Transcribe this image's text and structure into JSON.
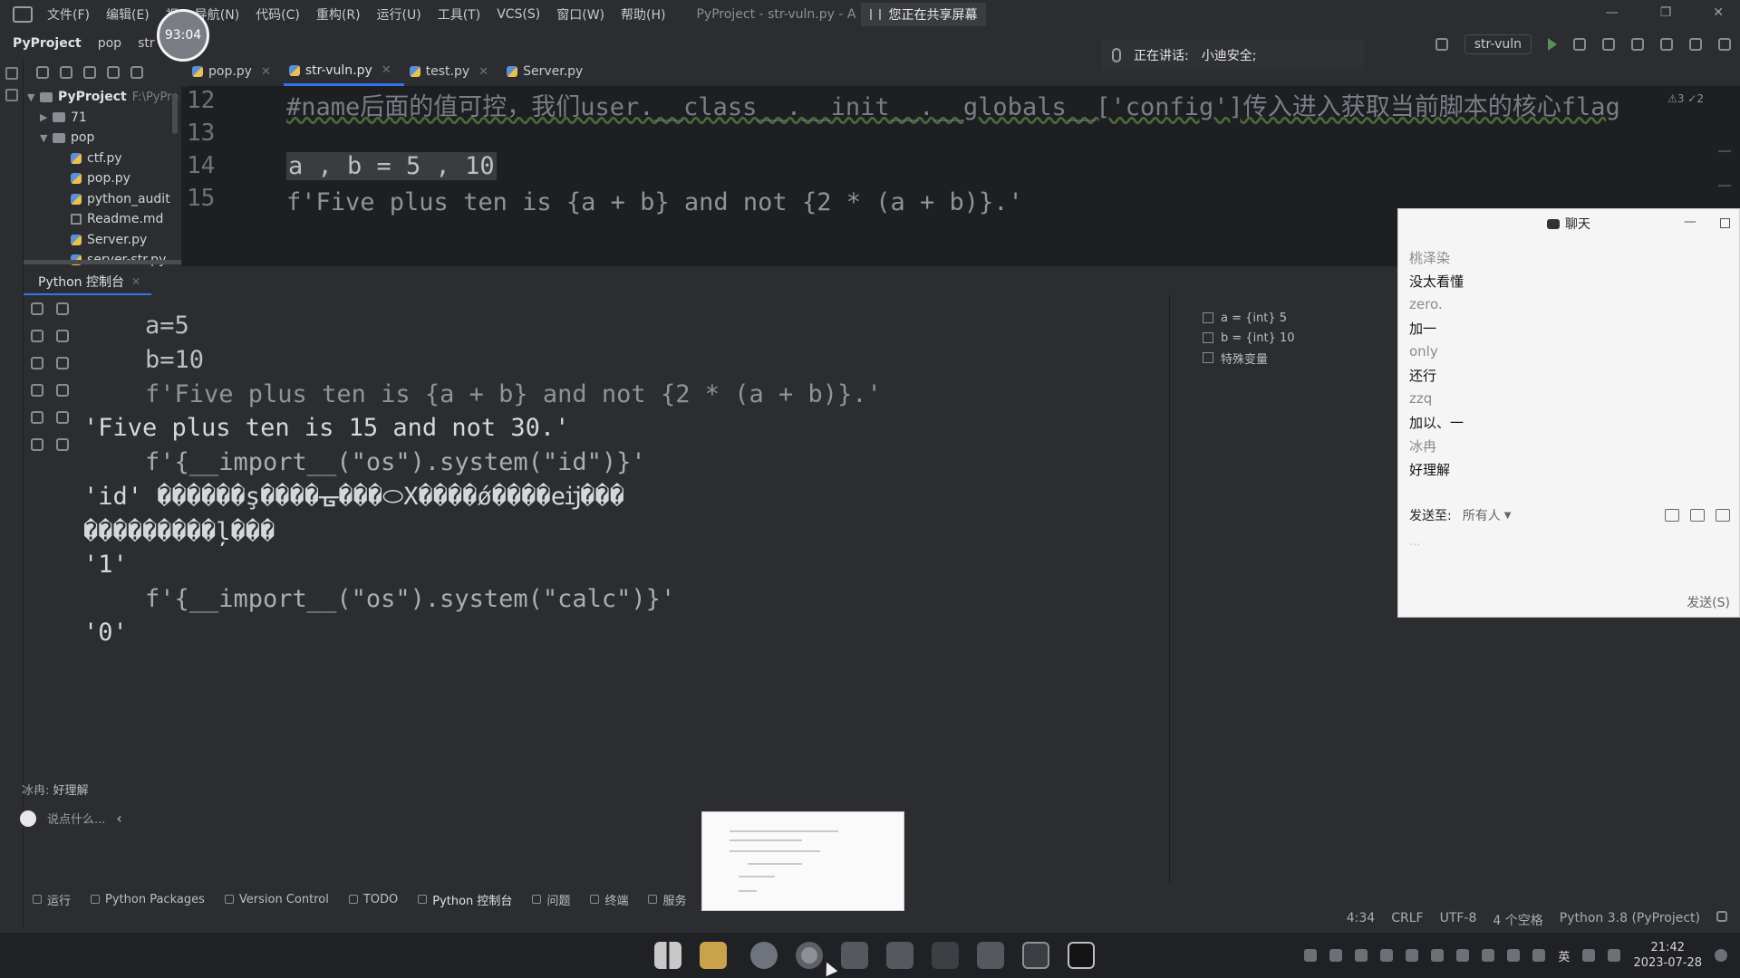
{
  "menubar": {
    "items": [
      "文件(F)",
      "编辑(E)",
      "视",
      "导航(N)",
      "代码(C)",
      "重构(R)",
      "运行(U)",
      "工具(T)",
      "VCS(S)",
      "窗口(W)",
      "帮助(H)"
    ],
    "title": "PyProject - str-vuln.py - A",
    "share_badge": "您正在共享屏幕"
  },
  "timer": "93:04",
  "navbar": {
    "project": "PyProject",
    "folder": "pop",
    "file": "str"
  },
  "meeting": {
    "speaking_label": "正在讲话:",
    "speaker": "小迪安全;"
  },
  "run_config": "str-vuln",
  "tabs": [
    {
      "label": "pop.py",
      "active": false
    },
    {
      "label": "str-vuln.py",
      "active": true
    },
    {
      "label": "test.py",
      "active": false
    },
    {
      "label": "Server.py",
      "active": false
    }
  ],
  "tree": {
    "root": "PyProject",
    "root_path": "F:\\PyPro",
    "items": [
      {
        "label": "71",
        "type": "folder",
        "indent": 1
      },
      {
        "label": "pop",
        "type": "folder",
        "indent": 1
      },
      {
        "label": "ctf.py",
        "type": "py",
        "indent": 2
      },
      {
        "label": "pop.py",
        "type": "py",
        "indent": 2
      },
      {
        "label": "python_audit",
        "type": "py",
        "indent": 2
      },
      {
        "label": "Readme.md",
        "type": "md",
        "indent": 2
      },
      {
        "label": "Server.py",
        "type": "py",
        "indent": 2
      },
      {
        "label": "server-str.py",
        "type": "py",
        "indent": 2
      }
    ]
  },
  "editor": {
    "line_numbers": [
      "12",
      "13",
      "14",
      "15"
    ],
    "line12": "#name后面的值可控，我们user.__class__.__init__.__globals__['config']传入进入获取当前脚本的核心flag",
    "line14": "a , b = 5 , 10",
    "line15": "f'Five plus ten is {a + b} and not {2 * (a + b)}.'",
    "inspection": "⚠3  ✓2"
  },
  "console": {
    "tab_label": "Python 控制台",
    "lines": [
      {
        "kind": "in",
        "text": "a=5"
      },
      {
        "kind": "in",
        "text": "b=10"
      },
      {
        "kind": "in",
        "text": "f'Five plus ten is {a + b} and not {2 * (a + b)}.'"
      },
      {
        "kind": "out",
        "text": "'Five plus ten is 15 and not 30.'"
      },
      {
        "kind": "in",
        "text": "f'{__import__(\"os\").system(\"id\")}'"
      },
      {
        "kind": "out",
        "text": "'id' ������ş����ᚗ���⬭X����ǿ����eĳ���"
      },
      {
        "kind": "out",
        "text": "���������ļ���"
      },
      {
        "kind": "out",
        "text": "'1'"
      },
      {
        "kind": "in",
        "text": "f'{__import__(\"os\").system(\"calc\")}'"
      },
      {
        "kind": "out",
        "text": "'0'"
      }
    ]
  },
  "variables": [
    {
      "label": "a = {int} 5"
    },
    {
      "label": "b = {int} 10"
    },
    {
      "label": "特殊变量"
    }
  ],
  "chat": {
    "title": "聊天",
    "messages": [
      {
        "name": "桃泽染",
        "text": "没太看懂"
      },
      {
        "name": "zero.",
        "text": "加一"
      },
      {
        "name": "only",
        "text": "还行"
      },
      {
        "name": "zzq",
        "text": "加以、一"
      },
      {
        "name": "冰冉",
        "text": "好理解"
      }
    ],
    "send_to_label": "发送至:",
    "send_to_value": "所有人",
    "input_placeholder": "...",
    "send_button": "发送(S)"
  },
  "danmaku": {
    "user": "冰冉:",
    "text": "好理解"
  },
  "comment_placeholder": "说点什么...",
  "tool_tabs": [
    "运行",
    "Python Packages",
    "Version Control",
    "TODO",
    "Python 控制台",
    "问题",
    "终端",
    "服务"
  ],
  "status": {
    "position": "4:34",
    "line_sep": "CRLF",
    "encoding": "UTF-8",
    "indent": "4 个空格",
    "interpreter": "Python 3.8 (PyProject)"
  },
  "taskbar": {
    "lang": "英",
    "time": "21:42",
    "date": "2023-07-28"
  }
}
